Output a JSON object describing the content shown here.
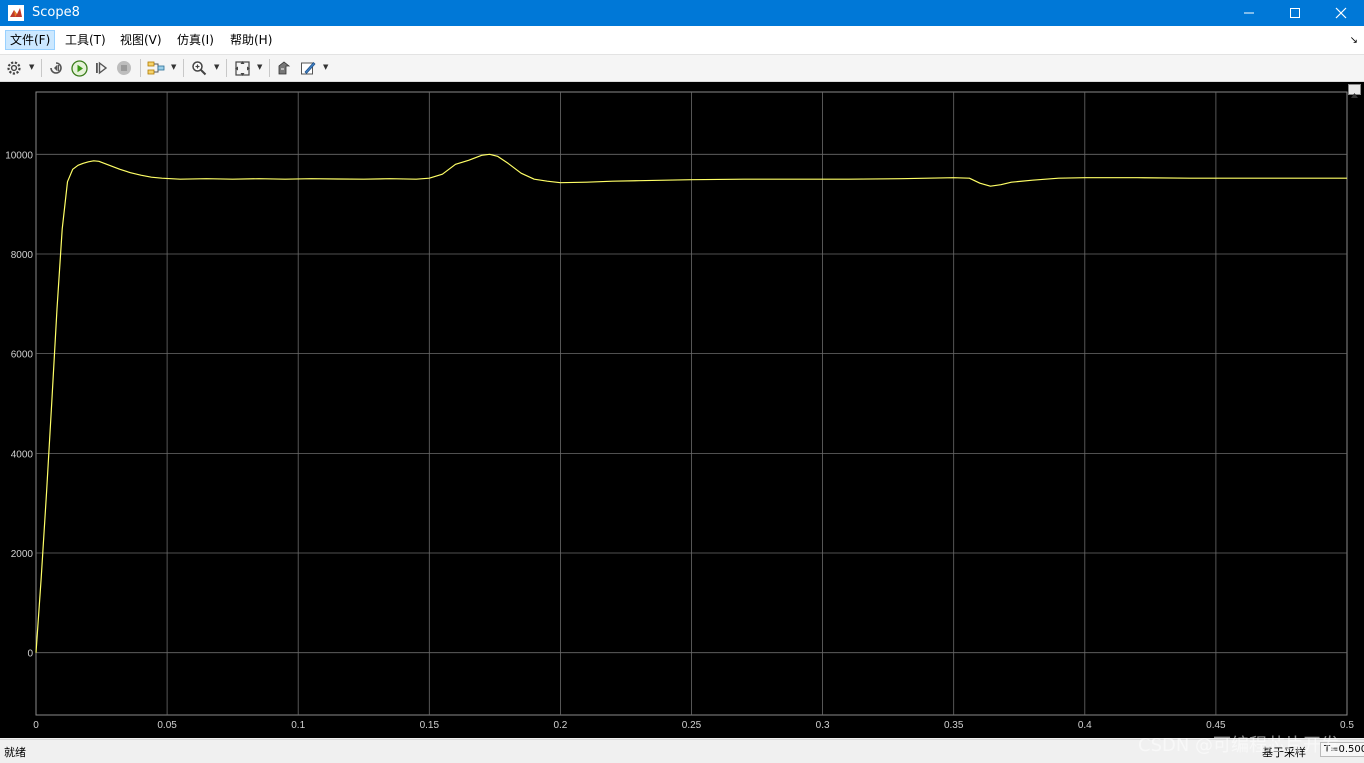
{
  "window": {
    "title": "Scope8",
    "controls": [
      "minimize-icon",
      "maximize-icon",
      "close-icon"
    ]
  },
  "menu": {
    "items": [
      {
        "label": "文件(F)"
      },
      {
        "label": "工具(T)"
      },
      {
        "label": "视图(V)"
      },
      {
        "label": "仿真(I)"
      },
      {
        "label": "帮助(H)"
      }
    ]
  },
  "toolbar": {
    "icons": [
      "settings-gear-icon",
      "step-back-icon",
      "run-icon",
      "step-forward-icon",
      "stop-icon",
      "highlight-simulink-block-icon",
      "zoom-in-icon",
      "autoscale-icon",
      "cursor-measurements-icon",
      "style-edit-icon"
    ]
  },
  "colors": {
    "plot_background": "#000000",
    "trace": "#ffff66",
    "grid": "#6b6b6b",
    "tick_label": "#d0d0d0",
    "titlebar": "#0078d7"
  },
  "chart_data": {
    "type": "line",
    "title": "",
    "xlabel": "",
    "ylabel": "",
    "xlim": [
      0,
      0.5
    ],
    "ylim": [
      -1250,
      11250
    ],
    "xticks": [
      0,
      0.05,
      0.1,
      0.15,
      0.2,
      0.25,
      0.3,
      0.35,
      0.4,
      0.45,
      0.5
    ],
    "xtick_labels": [
      "0",
      "0.05",
      "0.1",
      "0.15",
      "0.2",
      "0.25",
      "0.3",
      "0.35",
      "0.4",
      "0.45",
      "0.5"
    ],
    "yticks": [
      0,
      2000,
      4000,
      6000,
      8000,
      10000
    ],
    "ytick_labels": [
      "0",
      "2000",
      "4000",
      "6000",
      "8000",
      "10000"
    ],
    "grid": true,
    "series": [
      {
        "x": [
          0,
          0.002,
          0.004,
          0.006,
          0.008,
          0.01,
          0.012,
          0.014,
          0.016,
          0.018,
          0.02,
          0.022,
          0.024,
          0.028,
          0.032,
          0.036,
          0.04,
          0.044,
          0.048,
          0.055,
          0.065,
          0.075,
          0.085,
          0.095,
          0.105,
          0.115,
          0.125,
          0.135,
          0.145,
          0.15,
          0.155,
          0.16,
          0.165,
          0.17,
          0.173,
          0.176,
          0.18,
          0.185,
          0.19,
          0.195,
          0.2,
          0.21,
          0.22,
          0.23,
          0.24,
          0.25,
          0.27,
          0.29,
          0.31,
          0.33,
          0.35,
          0.356,
          0.36,
          0.364,
          0.368,
          0.372,
          0.38,
          0.39,
          0.4,
          0.42,
          0.44,
          0.46,
          0.48,
          0.5
        ],
        "y": [
          0,
          1500,
          3200,
          5000,
          6900,
          8500,
          9450,
          9700,
          9780,
          9820,
          9850,
          9870,
          9860,
          9780,
          9700,
          9630,
          9580,
          9540,
          9520,
          9500,
          9510,
          9500,
          9510,
          9500,
          9510,
          9505,
          9500,
          9510,
          9500,
          9520,
          9600,
          9800,
          9880,
          9980,
          10000,
          9960,
          9820,
          9620,
          9500,
          9460,
          9430,
          9440,
          9460,
          9470,
          9480,
          9490,
          9500,
          9500,
          9500,
          9510,
          9530,
          9520,
          9420,
          9360,
          9390,
          9440,
          9480,
          9520,
          9530,
          9530,
          9520,
          9520,
          9520,
          9520
        ]
      }
    ]
  },
  "status": {
    "text": "就绪",
    "sample_label": "基于采样",
    "time": "T=0.500"
  },
  "watermark": "CSDN @可编程芯片开发"
}
